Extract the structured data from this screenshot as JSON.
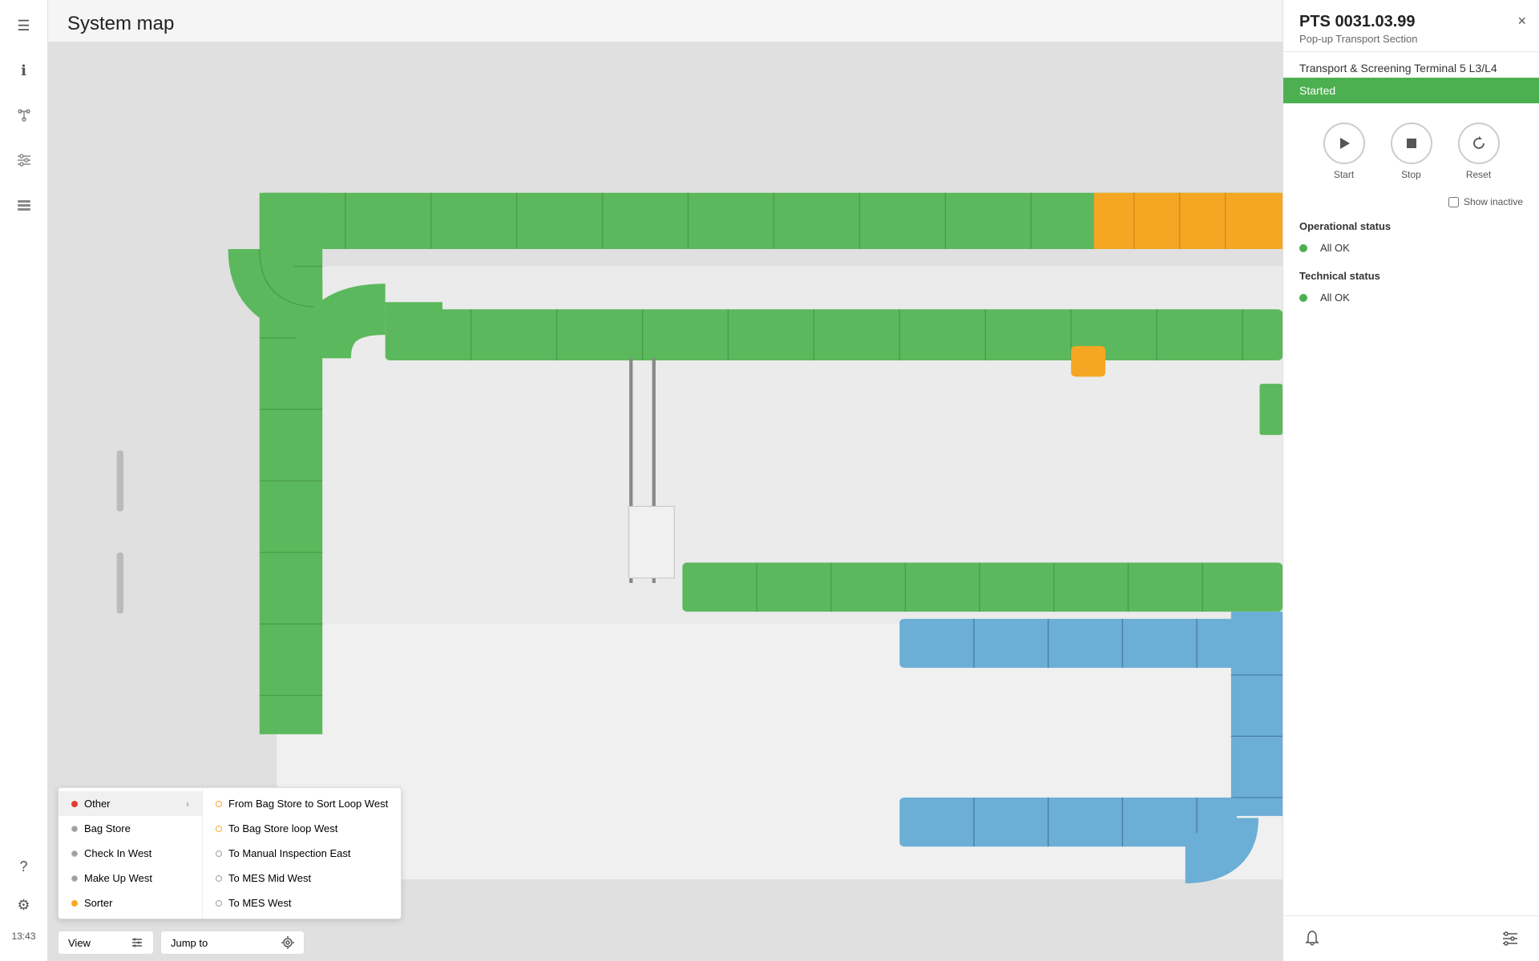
{
  "page": {
    "title": "System map",
    "time": "13:43"
  },
  "sidebar": {
    "icons": [
      {
        "name": "menu-icon",
        "symbol": "☰",
        "active": false
      },
      {
        "name": "info-icon",
        "symbol": "ℹ",
        "active": false
      },
      {
        "name": "node-icon",
        "symbol": "✦",
        "active": false
      },
      {
        "name": "filter-icon",
        "symbol": "⚙",
        "active": false
      },
      {
        "name": "list-icon",
        "symbol": "☰",
        "active": false
      }
    ],
    "bottom_icons": [
      {
        "name": "help-icon",
        "symbol": "?"
      },
      {
        "name": "settings-icon",
        "symbol": "⚙"
      }
    ]
  },
  "right_panel": {
    "title": "PTS 0031.03.99",
    "subtitle": "Pop-up Transport Section",
    "section_title": "Transport & Screening Terminal 5 L3/L4",
    "close_label": "×",
    "status": {
      "bar_text": "Started",
      "bar_color": "#4caf50"
    },
    "controls": {
      "start_label": "Start",
      "stop_label": "Stop",
      "reset_label": "Reset"
    },
    "show_inactive_label": "Show inactive",
    "operational_status": {
      "label": "Operational status",
      "value": "All OK",
      "color": "#4caf50"
    },
    "technical_status": {
      "label": "Technical status",
      "value": "All OK",
      "color": "#4caf50"
    },
    "bottom_icons": [
      {
        "name": "bell-icon",
        "symbol": "🔔"
      },
      {
        "name": "sliders-icon",
        "symbol": "⚙"
      }
    ]
  },
  "context_menu": {
    "items": [
      {
        "label": "Other",
        "dot_color": "red",
        "has_submenu": true,
        "active": true
      },
      {
        "label": "Bag Store",
        "dot_color": "gray",
        "has_submenu": false
      },
      {
        "label": "Check In West",
        "dot_color": "gray",
        "has_submenu": false
      },
      {
        "label": "Make Up West",
        "dot_color": "gray",
        "has_submenu": false
      },
      {
        "label": "Sorter",
        "dot_color": "yellow",
        "has_submenu": false
      }
    ],
    "submenu_items": [
      {
        "label": "From Bag Store to Sort Loop West",
        "dot_type": "orange"
      },
      {
        "label": "To Bag Store loop West",
        "dot_type": "orange"
      },
      {
        "label": "To Manual Inspection East",
        "dot_type": "normal"
      },
      {
        "label": "To MES Mid West",
        "dot_type": "normal"
      },
      {
        "label": "To MES West",
        "dot_type": "normal"
      }
    ]
  },
  "bottom_bar": {
    "view_label": "View",
    "jump_to_label": "Jump to",
    "view_icon": "⚙",
    "jump_icon": "◎"
  },
  "map": {
    "conveyor_color_green": "#5cb85c",
    "conveyor_color_orange": "#f5a623",
    "conveyor_color_blue": "#6baed6",
    "background": "#e0e0e0"
  }
}
